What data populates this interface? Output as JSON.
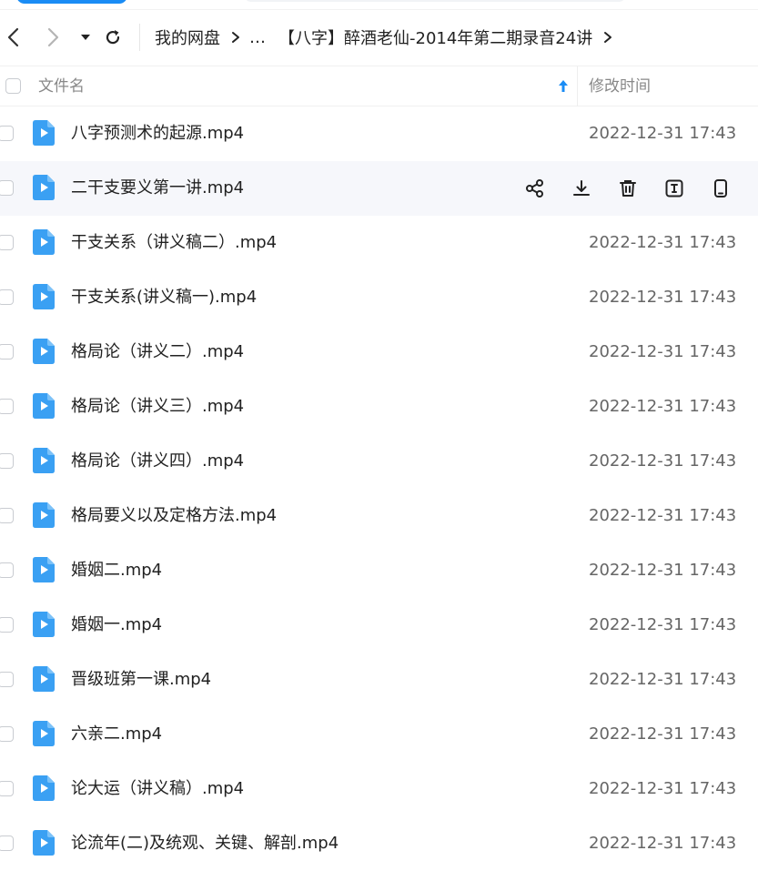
{
  "breadcrumb": {
    "items": [
      "我的网盘",
      "…",
      "【八字】醉酒老仙-2014年第二期录音24讲"
    ]
  },
  "header": {
    "name_label": "文件名",
    "time_label": "修改时间"
  },
  "files": [
    {
      "name": "八字预测术的起源.mp4",
      "time": "2022-12-31 17:43"
    },
    {
      "name": "二干支要义第一讲.mp4",
      "time": "",
      "hover": true
    },
    {
      "name": "干支关系（讲义稿二）.mp4",
      "time": "2022-12-31 17:43"
    },
    {
      "name": "干支关系(讲义稿一).mp4",
      "time": "2022-12-31 17:43"
    },
    {
      "name": "格局论（讲义二）.mp4",
      "time": "2022-12-31 17:43"
    },
    {
      "name": "格局论（讲义三）.mp4",
      "time": "2022-12-31 17:43"
    },
    {
      "name": "格局论（讲义四）.mp4",
      "time": "2022-12-31 17:43"
    },
    {
      "name": "格局要义以及定格方法.mp4",
      "time": "2022-12-31 17:43"
    },
    {
      "name": "婚姻二.mp4",
      "time": "2022-12-31 17:43"
    },
    {
      "name": "婚姻一.mp4",
      "time": "2022-12-31 17:43"
    },
    {
      "name": "晋级班第一课.mp4",
      "time": "2022-12-31 17:43"
    },
    {
      "name": "六亲二.mp4",
      "time": "2022-12-31 17:43"
    },
    {
      "name": "论大运（讲义稿）.mp4",
      "time": "2022-12-31 17:43"
    },
    {
      "name": "论流年(二)及统观、关键、解剖.mp4",
      "time": "2022-12-31 17:43"
    }
  ],
  "row_actions": [
    "share-icon",
    "download-icon",
    "trash-icon",
    "rename-icon",
    "phone-icon"
  ],
  "colors": {
    "accent": "#1a8cf5",
    "file_icon": "#3aa0f3",
    "hover_row": "#f6f7fb"
  }
}
